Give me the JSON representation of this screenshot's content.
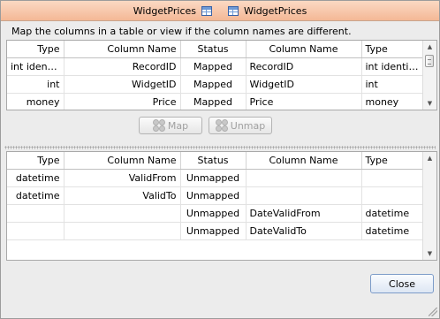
{
  "window": {
    "title_left": "WidgetPrices",
    "title_right": "WidgetPrices"
  },
  "instruction": "Map the columns in a table or view if the column names are different.",
  "headers": {
    "type": "Type",
    "column_name": "Column Name",
    "status": "Status"
  },
  "top_rows": [
    {
      "src_type": "int identit…",
      "src_col": "RecordID",
      "status": "Mapped",
      "dst_col": "RecordID",
      "dst_type": "int identit…"
    },
    {
      "src_type": "int",
      "src_col": "WidgetID",
      "status": "Mapped",
      "dst_col": "WidgetID",
      "dst_type": "int"
    },
    {
      "src_type": "money",
      "src_col": "Price",
      "status": "Mapped",
      "dst_col": "Price",
      "dst_type": "money"
    }
  ],
  "buttons": {
    "map": "Map",
    "unmap": "Unmap",
    "close": "Close"
  },
  "bottom_rows": [
    {
      "src_type": "datetime",
      "src_col": "ValidFrom",
      "status": "Unmapped",
      "dst_col": "",
      "dst_type": ""
    },
    {
      "src_type": "datetime",
      "src_col": "ValidTo",
      "status": "Unmapped",
      "dst_col": "",
      "dst_type": ""
    },
    {
      "src_type": "",
      "src_col": "",
      "status": "Unmapped",
      "dst_col": "DateValidFrom",
      "dst_type": "datetime"
    },
    {
      "src_type": "",
      "src_col": "",
      "status": "Unmapped",
      "dst_col": "DateValidTo",
      "dst_type": "datetime"
    }
  ],
  "icons": [
    "table-icon",
    "map-icon",
    "unmap-icon",
    "scroll-up-icon",
    "scroll-down-icon",
    "resize-grip-icon"
  ]
}
